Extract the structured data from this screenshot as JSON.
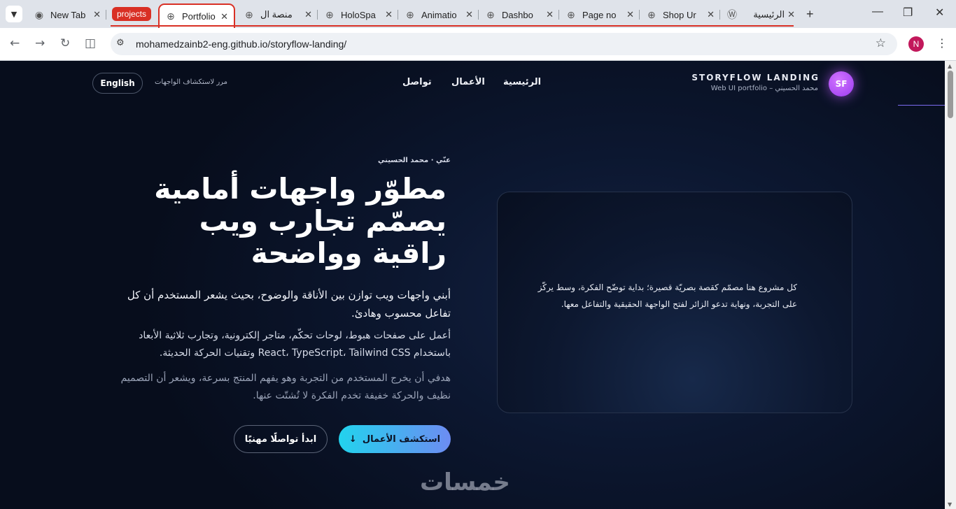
{
  "browser": {
    "tab_menu_icon": "chevron-down-icon",
    "tab_group_label": "projects",
    "tabs": [
      {
        "title": "New Tab",
        "icon": "chrome-icon"
      },
      {
        "title": "Portfolio",
        "icon": "globe-icon",
        "active": true
      },
      {
        "title": "منصة ال",
        "icon": "globe-icon"
      },
      {
        "title": "HoloSpa",
        "icon": "globe-icon"
      },
      {
        "title": "Animatio",
        "icon": "globe-icon"
      },
      {
        "title": "Dashbo",
        "icon": "globe-icon"
      },
      {
        "title": "Page no",
        "icon": "globe-icon"
      },
      {
        "title": "Shop Ur",
        "icon": "globe-icon"
      },
      {
        "title": "الرئيسية",
        "icon": "wordpress-icon"
      }
    ],
    "url": "mohamedzainb2-eng.github.io/storyflow-landing/",
    "profile_initial": "N",
    "colors": {
      "tab_group": "#d93025",
      "profile": "#c2185b"
    }
  },
  "site": {
    "brand_initials": "SF",
    "brand_title": "STORYFLOW LANDING",
    "brand_subtitle": "Web UI portfolio – محمد الحسيني",
    "nav": [
      "الرئيسية",
      "الأعمال",
      "تواصل"
    ],
    "scroll_hint": "مرر لاستكشاف الواجهات",
    "language_button": "English",
    "hero": {
      "eyebrow": "عنّي · محمد الحسيني",
      "title": "مطوّر واجهات أمامية يصمّم تجارب ويب راقية وواضحة",
      "paragraph_1": "أبني واجهات ويب توازن بين الأناقة والوضوح، بحيث يشعر المستخدم أن كل تفاعل محسوب وهادئ.",
      "paragraph_2": "أعمل على صفحات هبوط، لوحات تحكّم، متاجر إلكترونية، وتجارب ثلاثية الأبعاد باستخدام React، TypeScript، Tailwind CSS وتقنيات الحركة الحديثة.",
      "paragraph_3": "هدفي أن يخرج المستخدم من التجربة وهو يفهم المنتج بسرعة، ويشعر أن التصميم نظيف والحركة خفيفة تخدم الفكرة لا تُشتّت عنها.",
      "primary_button": "استكشف الأعمال",
      "primary_button_icon": "arrow-down-icon",
      "secondary_button": "ابدأ تواصلًا مهنيًا"
    },
    "card_text": "كل مشروع هنا مصمّم كقصة بصريّة قصيرة؛ بداية توضّح الفكرة، وسط يركّز على التجربة، ونهاية تدعو الزائر لفتح الواجهة الحقيقية والتفاعل معها.",
    "watermark": "خمسات",
    "colors": {
      "accent_cyan": "#22d3ee",
      "accent_purple": "#b44cf5",
      "background": "#0b1224"
    }
  }
}
